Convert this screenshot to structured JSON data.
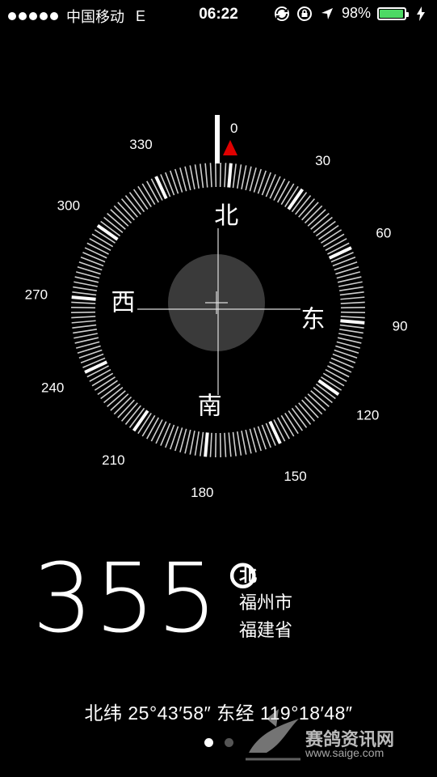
{
  "status": {
    "carrier": "中国移动",
    "network": "E",
    "time": "06:22",
    "battery_pct": "98%",
    "battery_level": 0.98,
    "battery_color": "#4cd964",
    "icons": [
      "sync-icon",
      "orientation-lock-icon",
      "location-arrow-icon",
      "charging-bolt-icon"
    ]
  },
  "compass": {
    "degree_labels": [
      "0",
      "30",
      "60",
      "90",
      "120",
      "150",
      "180",
      "210",
      "240",
      "270",
      "300",
      "330"
    ],
    "cardinals": {
      "north": "北",
      "east": "东",
      "south": "南",
      "west": "西"
    },
    "heading_deg": 355,
    "pointer_color": "#e00000"
  },
  "readout": {
    "heading": "355°",
    "direction": "北",
    "city": "福州市",
    "province": "福建省"
  },
  "coordinates": "北纬 25°43′58″  东经 119°18′48″",
  "pages": {
    "count": 2,
    "active": 0
  },
  "watermark": {
    "name": "赛鸽资讯网",
    "url": "www.saige.com"
  }
}
